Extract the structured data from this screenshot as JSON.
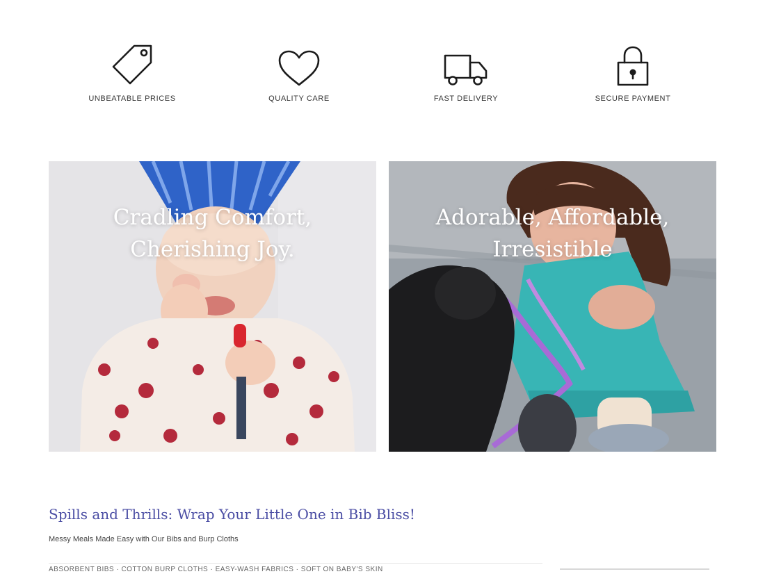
{
  "features": [
    {
      "icon": "price-tag-icon",
      "label": "Unbeatable Prices"
    },
    {
      "icon": "heart-icon",
      "label": "Quality Care"
    },
    {
      "icon": "truck-icon",
      "label": "Fast Delivery"
    },
    {
      "icon": "padlock-icon",
      "label": "Secure Payment"
    }
  ],
  "banners": [
    {
      "line1": "Cradling Comfort,",
      "line2": "Cherishing Joy."
    },
    {
      "line1": "Adorable, Affordable,",
      "line2": "Irresistible"
    }
  ],
  "promo": {
    "title": "Spills and Thrills: Wrap Your Little One in Bib Bliss!",
    "subtitle": "Messy Meals Made Easy with Our Bibs and Burp Cloths"
  },
  "footer_strip": {
    "text": "Absorbent bibs  ·  Cotton burp cloths  ·  Easy-wash fabrics  ·  Soft on baby's skin"
  },
  "colors": {
    "promo_title": "#4b4ea4",
    "icon_stroke": "#1b1b1b",
    "caption": "#ffffff"
  }
}
